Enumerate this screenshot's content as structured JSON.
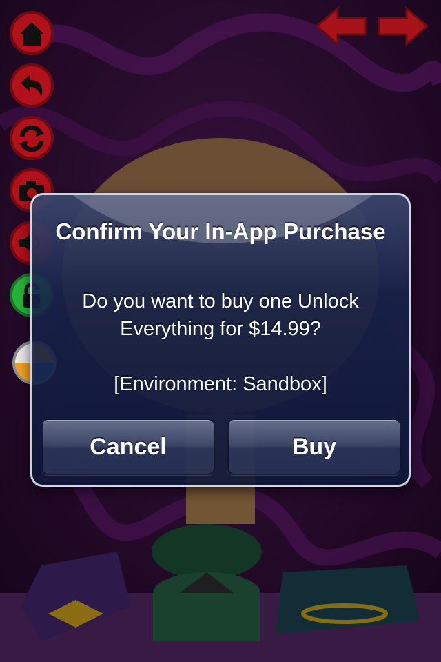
{
  "dialog": {
    "title": "Confirm Your In-App Purchase",
    "message": "Do you want to buy one Unlock Everything for $14.99?",
    "environment": "[Environment: Sandbox]",
    "cancel_label": "Cancel",
    "buy_label": "Buy"
  },
  "toolbar": {
    "buttons": [
      {
        "icon": "home-icon"
      },
      {
        "icon": "undo-icon"
      },
      {
        "icon": "refresh-icon"
      },
      {
        "icon": "camera-icon"
      },
      {
        "icon": "sound-icon"
      },
      {
        "icon": "lock-icon"
      },
      {
        "icon": "color-wheel-icon"
      }
    ]
  },
  "navigation": {
    "previous_icon": "arrow-left-icon",
    "next_icon": "arrow-right-icon"
  },
  "colors": {
    "toolbar_red": "#c0121a",
    "toolbar_green": "#2bbf3a",
    "background_purple": "#3a0d3f"
  }
}
